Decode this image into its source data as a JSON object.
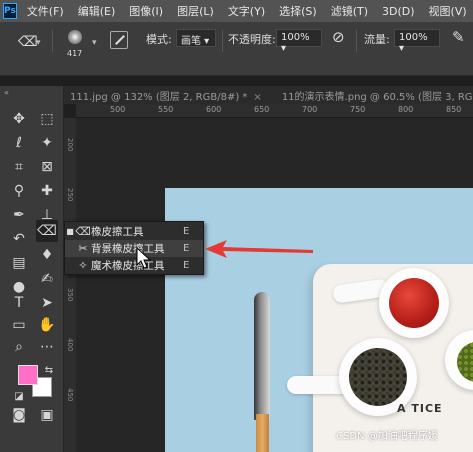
{
  "app": {
    "logo": "Ps"
  },
  "menu": [
    "文件(F)",
    "编辑(E)",
    "图像(I)",
    "图层(L)",
    "文字(Y)",
    "选择(S)",
    "滤镜(T)",
    "3D(D)",
    "视图(V)",
    "窗"
  ],
  "options": {
    "brush_size": "417",
    "mode_label": "模式:",
    "mode_value": "画笔",
    "opacity_label": "不透明度:",
    "opacity_value": "100%",
    "flow_label": "流量:",
    "flow_value": "100%"
  },
  "tabs": [
    {
      "label": "111.jpg @ 132% (图层 2, RGB/8#) *",
      "close": "×"
    },
    {
      "label": "11的演示表情.png @ 60.5% (图层 3, RGB",
      "close": ""
    }
  ],
  "ruler": {
    "top": [
      "500",
      "550",
      "600",
      "650",
      "700",
      "750",
      "800",
      "850"
    ],
    "left": [
      "200",
      "250",
      "300",
      "350",
      "400",
      "450"
    ]
  },
  "flyout": [
    {
      "label": "橡皮擦工具",
      "key": "E",
      "mark": "■",
      "icon": "eraser-icon"
    },
    {
      "label": "背景橡皮擦工具",
      "key": "E",
      "mark": "",
      "icon": "background-eraser-icon"
    },
    {
      "label": "魔术橡皮擦工具",
      "key": "E",
      "mark": "",
      "icon": "magic-eraser-icon"
    }
  ],
  "canvas": {
    "plate_text": "A TICE",
    "watermark": "CSDN @加油吧程序媛"
  },
  "colors": {
    "foreground": "#ff6ec7",
    "background": "#ffffff",
    "arrow": "#e53935",
    "canvas_bg": "#a9cfe3"
  }
}
